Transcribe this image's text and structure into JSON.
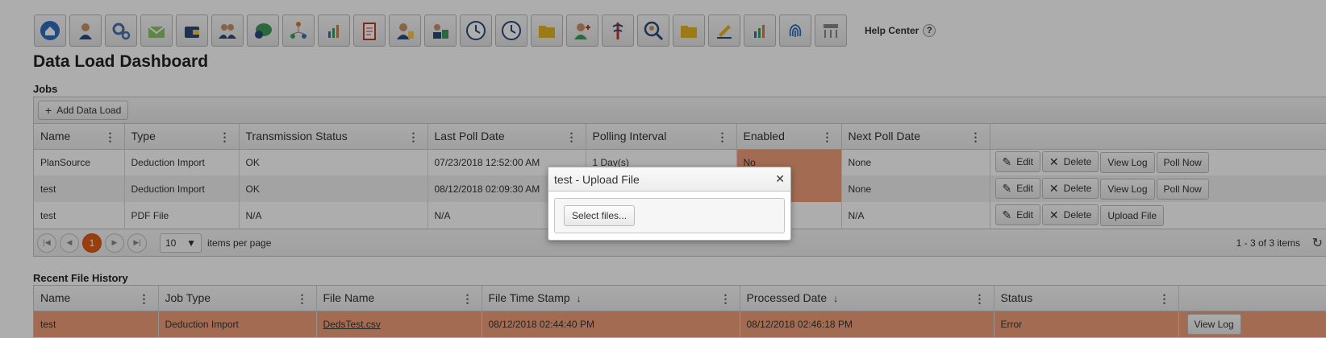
{
  "toolbar": {
    "icons": [
      "home-icon",
      "employee-icon",
      "gears-icon",
      "mail-check-icon",
      "wallet-icon",
      "users-icon",
      "chat-icon",
      "network-icon",
      "tools-chart-icon",
      "clipboard-icon",
      "person-doc-icon",
      "benefits-icon",
      "clock-icon",
      "clock2-icon",
      "folder-icon",
      "doctor-icon",
      "medical-icon",
      "search-person-icon",
      "folder2-icon",
      "pen-chart-icon",
      "tools-chart2-icon",
      "fingerprint-icon",
      "settings-table-icon"
    ],
    "help_label": "Help Center",
    "help_q": "?"
  },
  "page_title": "Data Load Dashboard",
  "jobs": {
    "title": "Jobs",
    "add_label": "Add Data Load",
    "columns": [
      "Name",
      "Type",
      "Transmission Status",
      "Last Poll Date",
      "Polling Interval",
      "Enabled",
      "Next Poll Date"
    ],
    "rows": [
      {
        "name": "PlanSource",
        "type": "Deduction Import",
        "status": "OK",
        "last_poll": "07/23/2018 12:52:00 AM",
        "interval": "1 Day(s)",
        "enabled": "No",
        "next_poll": "None",
        "actions": [
          "Edit",
          "Delete",
          "View Log",
          "Poll Now"
        ]
      },
      {
        "name": "test",
        "type": "Deduction Import",
        "status": "OK",
        "last_poll": "08/12/2018 02:09:30 AM",
        "interval": "",
        "enabled": "",
        "next_poll": "None",
        "actions": [
          "Edit",
          "Delete",
          "View Log",
          "Poll Now"
        ]
      },
      {
        "name": "test",
        "type": "PDF File",
        "status": "N/A",
        "last_poll": "N/A",
        "interval": "",
        "enabled": "",
        "next_poll": "N/A",
        "actions": [
          "Edit",
          "Delete",
          "Upload File"
        ]
      }
    ],
    "pager": {
      "current": "1",
      "page_size": "10",
      "items_per_page_label": "items per page",
      "info": "1 - 3 of 3 items"
    }
  },
  "history": {
    "title": "Recent File History",
    "columns": [
      "Name",
      "Job Type",
      "File Name",
      "File Time Stamp",
      "Processed Date",
      "Status"
    ],
    "rows": [
      {
        "name": "test",
        "job_type": "Deduction Import",
        "file_name": "DedsTest.csv",
        "file_ts": "08/12/2018 02:44:40 PM",
        "processed": "08/12/2018 02:46:18 PM",
        "status": "Error",
        "action": "View Log"
      }
    ]
  },
  "modal": {
    "title": "test - Upload File",
    "close": "✕",
    "select_label": "Select files..."
  },
  "colors": {
    "accent": "#e25c14",
    "error_row": "#f0a07a"
  }
}
